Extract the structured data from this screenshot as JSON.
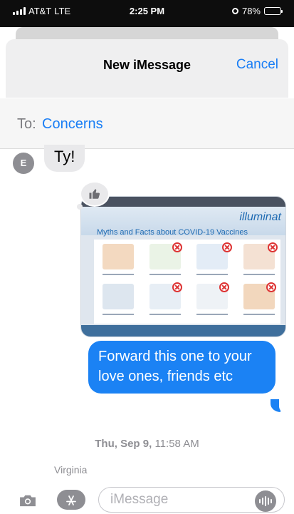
{
  "status_bar": {
    "carrier": "AT&T",
    "network": "LTE",
    "time": "2:25 PM",
    "battery": "78%",
    "icons": [
      "signal-icon",
      "alarm-icon",
      "battery-icon"
    ]
  },
  "header": {
    "title": "New iMessage",
    "cancel_label": "Cancel"
  },
  "recipients": {
    "label": "To:",
    "name": "Concerns"
  },
  "conversation": {
    "incoming": {
      "avatar_initial": "E",
      "text": "Ty!"
    },
    "tapback_icon": "thumbs-up-icon",
    "image_attachment": {
      "heading": "Myths and Facts about COVID-19 Vaccines",
      "brand": "illuminat"
    },
    "outgoing": {
      "text": "Forward this one to your love ones, friends etc"
    },
    "timestamp": {
      "day": "Thu, Sep 9,",
      "time": "11:58 AM"
    },
    "sender_name": "Virginia"
  },
  "compose": {
    "placeholder": "iMessage",
    "value": ""
  },
  "colors": {
    "accent": "#1a7ef5",
    "outgoing_bubble": "#1b82f4",
    "incoming_bubble": "#e9e9eb"
  }
}
